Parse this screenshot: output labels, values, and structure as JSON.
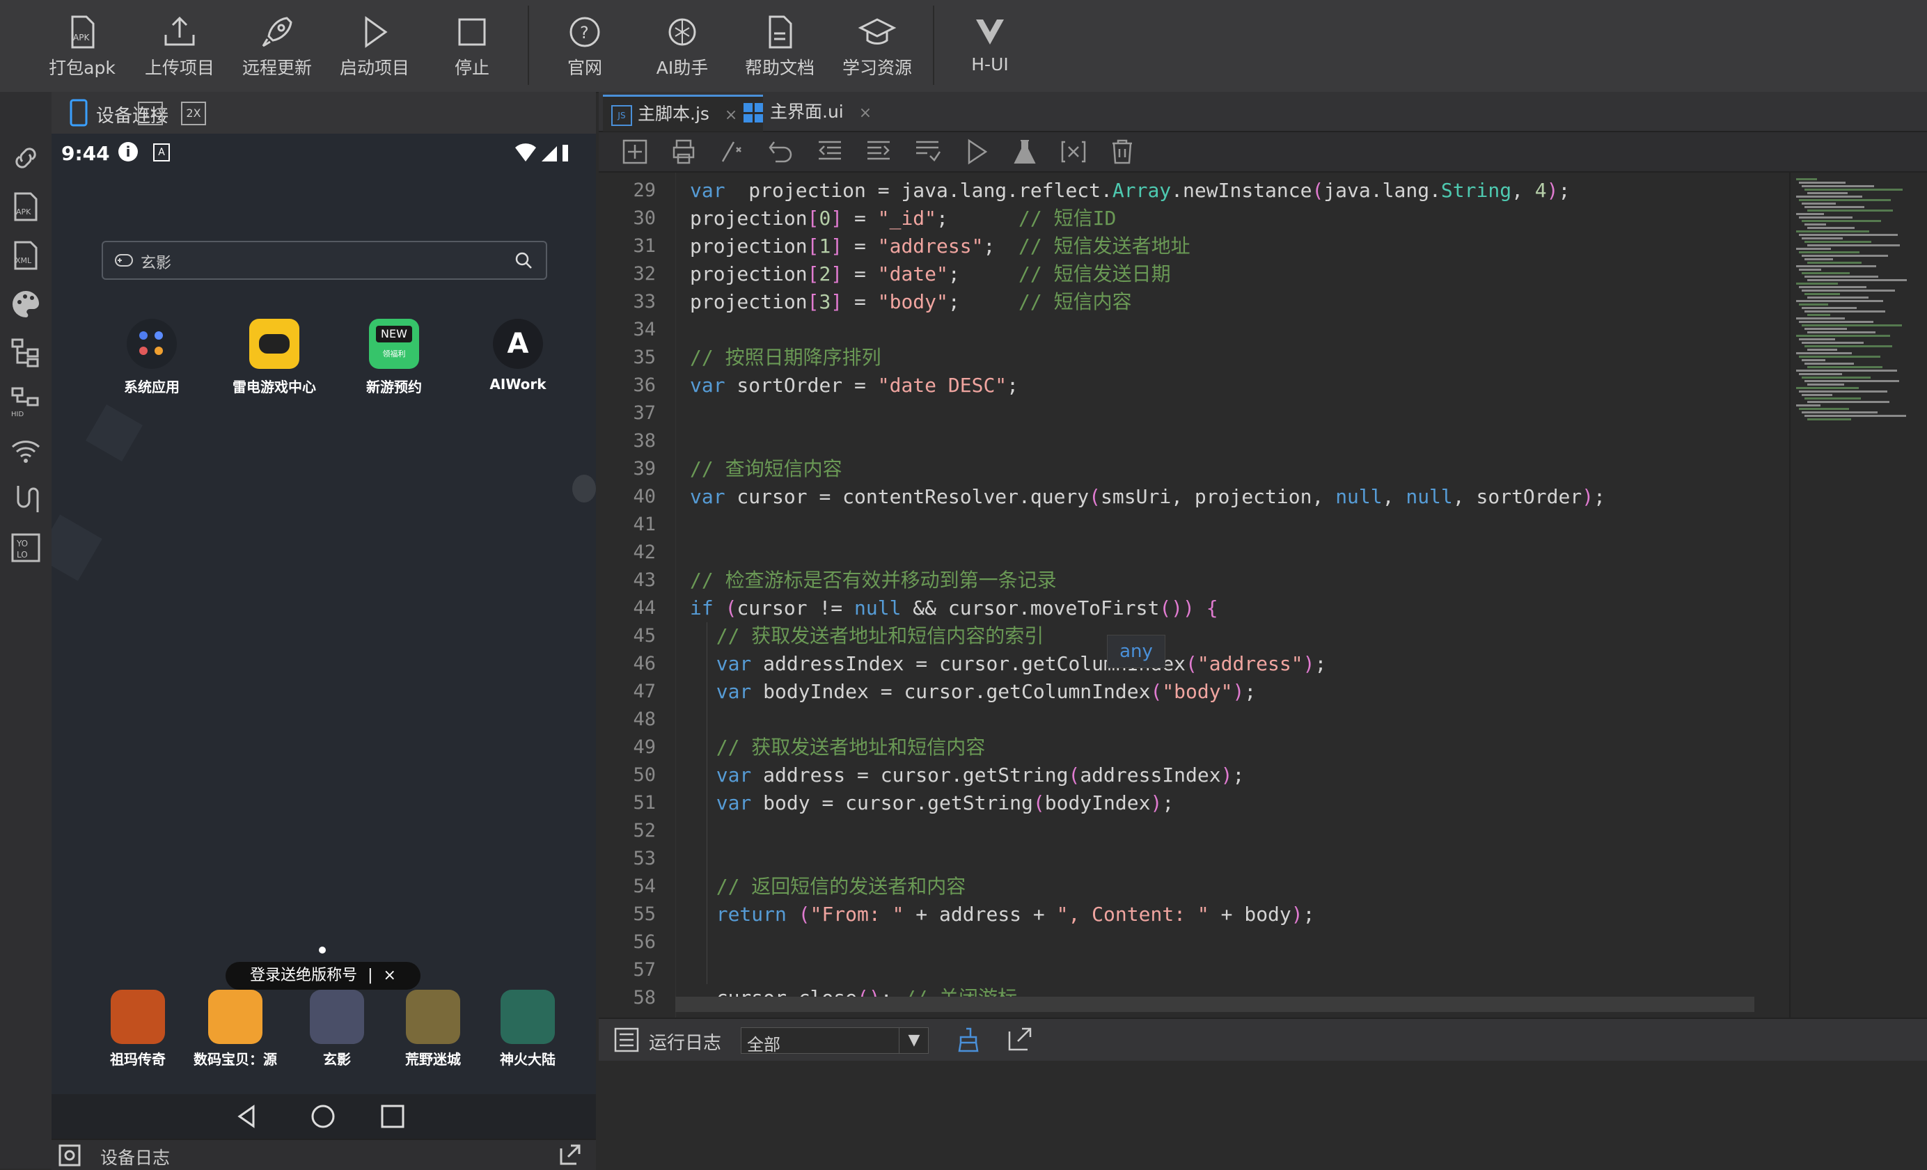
{
  "toolbar": {
    "items": [
      {
        "label": "打包apk",
        "icon": "apk-package-icon"
      },
      {
        "label": "上传项目",
        "icon": "upload-icon"
      },
      {
        "label": "远程更新",
        "icon": "rocket-icon"
      },
      {
        "label": "启动项目",
        "icon": "play-icon"
      },
      {
        "label": "停止",
        "icon": "stop-icon"
      },
      {
        "label": "官网",
        "icon": "help-circle-icon"
      },
      {
        "label": "AI助手",
        "icon": "ai-knot-icon"
      },
      {
        "label": "帮助文档",
        "icon": "document-icon"
      },
      {
        "label": "学习资源",
        "icon": "graduation-cap-icon"
      },
      {
        "label": "H-UI",
        "icon": "hui-logo-icon"
      }
    ]
  },
  "device_panel": {
    "title": "设备连接",
    "zoom_1x": "1X",
    "zoom_2x": "2X",
    "status_time": "9:44",
    "search_placeholder": "玄影",
    "apps_row1": [
      {
        "label": "系统应用"
      },
      {
        "label": "雷电游戏中心"
      },
      {
        "label": "新游预约",
        "badge": "NEW",
        "sub": "领福利"
      },
      {
        "label": "AIWork"
      }
    ],
    "toast": "登录送绝版称号",
    "toast_sep": "|",
    "toast_close": "×",
    "dock_apps": [
      {
        "label": "祖玛传奇"
      },
      {
        "label": "数码宝贝：源"
      },
      {
        "label": "玄影"
      },
      {
        "label": "荒野迷城"
      },
      {
        "label": "神火大陆"
      }
    ],
    "device_log_label": "设备日志"
  },
  "left_strip": {
    "icons": [
      "link-icon",
      "apk-file-icon",
      "xml-file-icon",
      "palette-icon",
      "tree-icon",
      "hid-tree-icon",
      "wifi-icon",
      "usb-icon",
      "yolo-icon"
    ]
  },
  "editor": {
    "tabs": [
      {
        "label": "主脚本.js",
        "icon": "js-file-icon",
        "close": "×"
      },
      {
        "label": "主界面.ui",
        "icon": "ui-grid-icon",
        "close": "×"
      }
    ],
    "tools": [
      "add-icon",
      "print-icon",
      "comment-icon",
      "undo-icon",
      "indent-left-icon",
      "indent-right-icon",
      "format-icon",
      "run-icon",
      "flask-icon",
      "variable-icon",
      "clear-icon"
    ],
    "hover_tip": "any",
    "lines": [
      {
        "n": "29",
        "segs": [
          [
            "kw",
            "var"
          ],
          [
            "",
            "  projection = java.lang.reflect."
          ],
          [
            "ty",
            "Array"
          ],
          [
            "",
            ".newInstance"
          ],
          [
            "pn",
            "("
          ],
          [
            "",
            "java.lang."
          ],
          [
            "ty",
            "String"
          ],
          [
            "",
            ", "
          ],
          [
            "num",
            "4"
          ],
          [
            "pn",
            ")"
          ],
          [
            "",
            ";"
          ]
        ]
      },
      {
        "n": "30",
        "segs": [
          [
            "",
            "projection"
          ],
          [
            "pn",
            "["
          ],
          [
            "num",
            "0"
          ],
          [
            "pn",
            "]"
          ],
          [
            "",
            " = "
          ],
          [
            "str",
            "\"_id\""
          ],
          [
            "",
            ";      "
          ],
          [
            "cm",
            "// 短信ID"
          ]
        ]
      },
      {
        "n": "31",
        "segs": [
          [
            "",
            "projection"
          ],
          [
            "pn",
            "["
          ],
          [
            "num",
            "1"
          ],
          [
            "pn",
            "]"
          ],
          [
            "",
            " = "
          ],
          [
            "str",
            "\"address\""
          ],
          [
            "",
            ";  "
          ],
          [
            "cm",
            "// 短信发送者地址"
          ]
        ]
      },
      {
        "n": "32",
        "segs": [
          [
            "",
            "projection"
          ],
          [
            "pn",
            "["
          ],
          [
            "num",
            "2"
          ],
          [
            "pn",
            "]"
          ],
          [
            "",
            " = "
          ],
          [
            "str",
            "\"date\""
          ],
          [
            "",
            ";     "
          ],
          [
            "cm",
            "// 短信发送日期"
          ]
        ]
      },
      {
        "n": "33",
        "segs": [
          [
            "",
            "projection"
          ],
          [
            "pn",
            "["
          ],
          [
            "num",
            "3"
          ],
          [
            "pn",
            "]"
          ],
          [
            "",
            " = "
          ],
          [
            "str",
            "\"body\""
          ],
          [
            "",
            ";     "
          ],
          [
            "cm",
            "// 短信内容"
          ]
        ]
      },
      {
        "n": "34",
        "segs": []
      },
      {
        "n": "35",
        "segs": [
          [
            "cm",
            "// 按照日期降序排列"
          ]
        ]
      },
      {
        "n": "36",
        "segs": [
          [
            "kw",
            "var"
          ],
          [
            "",
            " sortOrder = "
          ],
          [
            "str",
            "\"date DESC\""
          ],
          [
            "",
            ";"
          ]
        ]
      },
      {
        "n": "37",
        "segs": []
      },
      {
        "n": "38",
        "segs": []
      },
      {
        "n": "39",
        "segs": [
          [
            "cm",
            "// 查询短信内容"
          ]
        ]
      },
      {
        "n": "40",
        "segs": [
          [
            "kw",
            "var"
          ],
          [
            "",
            " cursor = contentResolver.query"
          ],
          [
            "pn",
            "("
          ],
          [
            "",
            "smsUri, projection, "
          ],
          [
            "kw",
            "null"
          ],
          [
            "",
            ", "
          ],
          [
            "kw",
            "null"
          ],
          [
            "",
            ", sortOrder"
          ],
          [
            "pn",
            ")"
          ],
          [
            "",
            ";"
          ]
        ]
      },
      {
        "n": "41",
        "segs": []
      },
      {
        "n": "42",
        "segs": []
      },
      {
        "n": "43",
        "segs": [
          [
            "cm",
            "// 检查游标是否有效并移动到第一条记录"
          ]
        ]
      },
      {
        "n": "44",
        "segs": [
          [
            "kw",
            "if"
          ],
          [
            "",
            " "
          ],
          [
            "pn",
            "("
          ],
          [
            "",
            "cursor != "
          ],
          [
            "kw",
            "null"
          ],
          [
            "",
            " && cursor.moveToFirst"
          ],
          [
            "pn",
            "()) {"
          ]
        ]
      },
      {
        "n": "45",
        "segs": [
          [
            "",
            "  "
          ],
          [
            "cm",
            "// 获取发送者地址和短信内容的索引"
          ]
        ]
      },
      {
        "n": "46",
        "segs": [
          [
            "",
            "  "
          ],
          [
            "kw",
            "var"
          ],
          [
            "",
            " addressIndex = cursor.getColumnIndex"
          ],
          [
            "pn",
            "("
          ],
          [
            "str",
            "\"address\""
          ],
          [
            "pn",
            ")"
          ],
          [
            "",
            ";"
          ]
        ]
      },
      {
        "n": "47",
        "segs": [
          [
            "",
            "  "
          ],
          [
            "kw",
            "var"
          ],
          [
            "",
            " bodyIndex = cursor.getColumnIndex"
          ],
          [
            "pn",
            "("
          ],
          [
            "str",
            "\"body\""
          ],
          [
            "pn",
            ")"
          ],
          [
            "",
            ";"
          ]
        ]
      },
      {
        "n": "48",
        "segs": []
      },
      {
        "n": "49",
        "segs": [
          [
            "",
            "  "
          ],
          [
            "cm",
            "// 获取发送者地址和短信内容"
          ]
        ]
      },
      {
        "n": "50",
        "segs": [
          [
            "",
            "  "
          ],
          [
            "kw",
            "var"
          ],
          [
            "",
            " address = cursor.getString"
          ],
          [
            "pn",
            "("
          ],
          [
            "",
            "addressIndex"
          ],
          [
            "pn",
            ")"
          ],
          [
            "",
            ";"
          ]
        ]
      },
      {
        "n": "51",
        "segs": [
          [
            "",
            "  "
          ],
          [
            "kw",
            "var"
          ],
          [
            "",
            " body = cursor.getString"
          ],
          [
            "pn",
            "("
          ],
          [
            "",
            "bodyIndex"
          ],
          [
            "pn",
            ")"
          ],
          [
            "",
            ";"
          ]
        ]
      },
      {
        "n": "52",
        "segs": []
      },
      {
        "n": "53",
        "segs": []
      },
      {
        "n": "54",
        "segs": [
          [
            "",
            "  "
          ],
          [
            "cm",
            "// 返回短信的发送者和内容"
          ]
        ]
      },
      {
        "n": "55",
        "segs": [
          [
            "",
            "  "
          ],
          [
            "kw",
            "return"
          ],
          [
            "",
            " "
          ],
          [
            "pn",
            "("
          ],
          [
            "str",
            "\"From: \""
          ],
          [
            "",
            " + address + "
          ],
          [
            "str",
            "\", Content: \""
          ],
          [
            "",
            " + body"
          ],
          [
            "pn",
            ")"
          ],
          [
            "",
            ";"
          ]
        ]
      },
      {
        "n": "56",
        "segs": []
      },
      {
        "n": "57",
        "segs": []
      },
      {
        "n": "58",
        "segs": [
          [
            "",
            "  cursor.close"
          ],
          [
            "pn",
            "()"
          ],
          [
            "",
            "; "
          ],
          [
            "cm",
            "// 关闭游标"
          ]
        ]
      }
    ]
  },
  "bottom": {
    "log_label": "运行日志",
    "filter_value": "全部"
  },
  "colors": {
    "keyword": "#569cd6",
    "string": "#f0a5a0",
    "comment": "#6a9955",
    "type": "#4ec9b0",
    "number": "#b5cea8",
    "accent": "#4a90d9"
  }
}
